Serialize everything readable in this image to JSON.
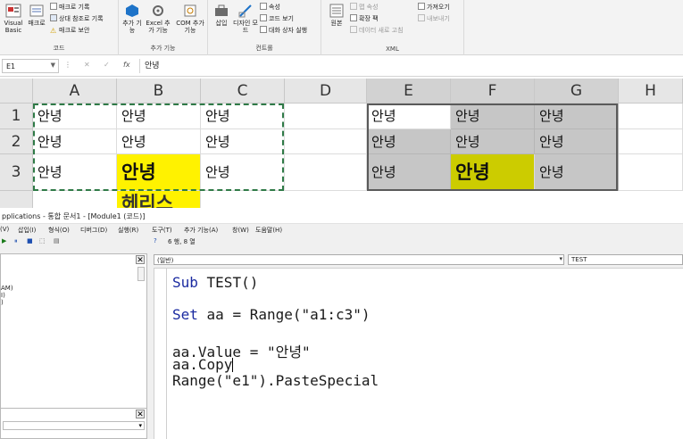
{
  "ribbon": {
    "groups": [
      {
        "label": "코드",
        "buttons": [
          "Visual Basic",
          "매크로"
        ],
        "small": [
          "매크로 기록",
          "상대 참조로 기록",
          "매크로 보안"
        ]
      },
      {
        "label": "추가 기능",
        "buttons": [
          "추가 기능",
          "Excel 추가 기능",
          "COM 추가 기능"
        ]
      },
      {
        "label": "컨트롤",
        "buttons": [
          "삽입",
          "디자인 모드"
        ],
        "small": [
          "속성",
          "코드 보기",
          "대화 상자 실행"
        ]
      },
      {
        "label": "XML",
        "buttons": [
          "원본"
        ],
        "small": [
          "맵 속성",
          "확장 팩",
          "데이터 새로 고침",
          "가져오기",
          "내보내기"
        ]
      }
    ]
  },
  "formula_bar": {
    "name_box": "E1",
    "fx": "fx",
    "value": "안녕"
  },
  "sheet": {
    "columns": [
      "A",
      "B",
      "C",
      "D",
      "E",
      "F",
      "G",
      "H"
    ],
    "rows": [
      "1",
      "2",
      "3"
    ],
    "cells": {
      "A1": "안녕",
      "B1": "안녕",
      "C1": "안녕",
      "A2": "안녕",
      "B2": "안녕",
      "C2": "안녕",
      "A3": "안녕",
      "B3": "안녕",
      "C3": "안녕",
      "E1": "안녕",
      "F1": "안녕",
      "G1": "안녕",
      "E2": "안녕",
      "F2": "안녕",
      "G2": "안녕",
      "E3": "안녕",
      "F3": "안녕",
      "G3": "안녕",
      "B4_partial": "헤리스"
    },
    "colors": {
      "yellow": "#fff200",
      "olive": "#cccc00",
      "selection_gray": "#c6c6c6",
      "copy_marquee": "#2f7a47"
    }
  },
  "vbe": {
    "title": "pplications - 통합 문서1 - [Module1 (코드)]",
    "menu": [
      "(V)",
      "삽입(I)",
      "형식(O)",
      "디버그(D)",
      "실행(R)",
      "도구(T)",
      "추가 기능(A)",
      "창(W)",
      "도움말(H)"
    ],
    "position": "6 행, 8 열",
    "project_items": [
      "AM)",
      "I)",
      ")"
    ],
    "object_combo": "(일반)",
    "proc_combo": "TEST",
    "code_lines": [
      {
        "kw": "Sub",
        "rest": " TEST()"
      },
      {
        "kw": "",
        "rest": ""
      },
      {
        "kw": "Set",
        "rest": " aa = Range(\"a1:c3\")"
      },
      {
        "kw": "",
        "rest": ""
      },
      {
        "kw": "",
        "rest": "aa.Value = \"안녕\""
      },
      {
        "kw": "",
        "rest": "aa.Copy"
      },
      {
        "kw": "",
        "rest": "Range(\"e1\").PasteSpecial"
      }
    ]
  }
}
